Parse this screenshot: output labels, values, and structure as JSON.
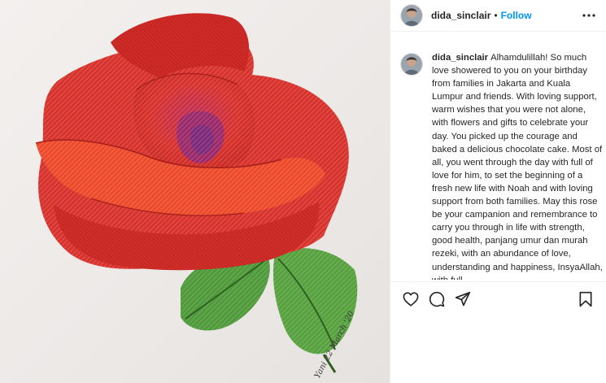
{
  "post": {
    "username": "dida_sinclair",
    "follow_label": "Follow",
    "separator": "•",
    "caption": "Alhamdulillah! So much love showered to you on your birthday from families in Jakarta and Kuala Lumpur and friends. With loving support, warm wishes that you were not alone, with flowers and gifts to celebrate your day. You picked up the courage and baked a delicious chocolate cake. Most of all, you went through the day with full of love for him, to set the beginning of a fresh new life with Noah and with loving support from both families. May this rose be your campanion and remembrance to carry you through in life with strength, good health, panjang umur dan murah rezeki, with an abundance of love, understanding and happiness, InsyaAllah, with full",
    "artwork_signature": "Yani 22 March '20"
  },
  "icons": {
    "more": "more-options-icon",
    "like": "heart-icon",
    "comment": "comment-icon",
    "share": "share-icon",
    "save": "bookmark-icon"
  },
  "colors": {
    "follow": "#0095f6",
    "text": "#262626",
    "border": "#efefef",
    "rose": "#d8322c",
    "leaf": "#4f9a3a"
  }
}
